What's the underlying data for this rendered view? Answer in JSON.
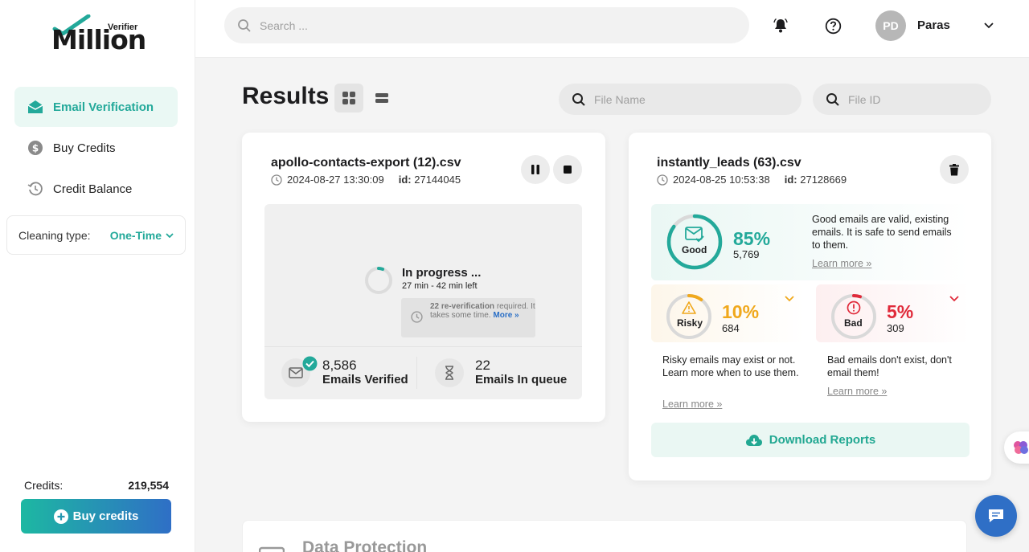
{
  "brand": {
    "logo_main": "Million",
    "logo_sub": "Verifier"
  },
  "sidebar": {
    "items": [
      {
        "label": "Email Verification",
        "icon": "envelope-open-icon",
        "active": true
      },
      {
        "label": "Buy Credits",
        "icon": "dollar-coin-icon",
        "active": false
      },
      {
        "label": "Credit Balance",
        "icon": "history-icon",
        "active": false
      }
    ],
    "cleaning_label": "Cleaning type:",
    "cleaning_value": "One-Time",
    "credits_label": "Credits:",
    "credits_value": "219,554",
    "buy_button": "Buy credits"
  },
  "topbar": {
    "search_placeholder": "Search ...",
    "user_initials": "PD",
    "user_name": "Paras"
  },
  "main": {
    "title": "Results",
    "file_name_placeholder": "File Name",
    "file_id_placeholder": "File ID"
  },
  "card1": {
    "filename": "apollo-contacts-export (12).csv",
    "date": "2024-08-27 13:30:09",
    "id_label": "id:",
    "id_value": "27144045",
    "status": "In progress ...",
    "eta": "27 min - 42 min left",
    "tip_bold": "22 re-verification",
    "tip_text": "required. It takes some time.",
    "tip_more": "More »",
    "verified_count": "8,586",
    "verified_label": "Emails Verified",
    "queue_count": "22",
    "queue_label": "Emails In queue"
  },
  "card2": {
    "filename": "instantly_leads (63).csv",
    "date": "2024-08-25 10:53:38",
    "id_label": "id:",
    "id_value": "27128669",
    "good": {
      "label": "Good",
      "percent": "85%",
      "count": "5,769",
      "fraction": 0.85,
      "desc": "Good emails are valid, existing emails. It is safe to send emails to them.",
      "learn": "Learn more »"
    },
    "risky": {
      "label": "Risky",
      "percent": "10%",
      "count": "684",
      "fraction": 0.1,
      "desc": "Risky emails may exist or not. Learn more when to use them.",
      "learn": "Learn more »"
    },
    "bad": {
      "label": "Bad",
      "percent": "5%",
      "count": "309",
      "fraction": 0.05,
      "desc": "Bad emails don't exist, don't email them!",
      "learn": "Learn more »"
    },
    "download": "Download Reports"
  },
  "data_protection": {
    "title": "Data Protection"
  },
  "colors": {
    "accent": "#23a99a",
    "good": "#23a99a",
    "risky": "#f0a81c",
    "bad": "#e02a3a",
    "brand_blue": "#2f6fc6"
  }
}
